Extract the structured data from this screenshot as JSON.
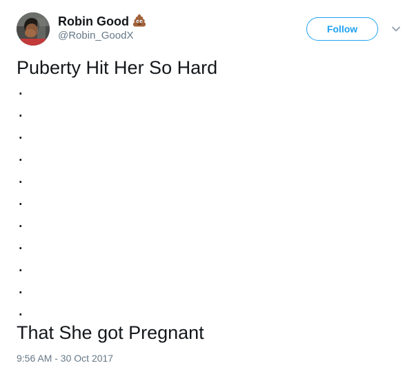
{
  "author": {
    "display_name": "Robin Good",
    "name_emoji": "pile-of-poo-emoji",
    "handle": "@Robin_GoodX"
  },
  "actions": {
    "follow_label": "Follow",
    "caret_icon": "chevron-down-icon"
  },
  "tweet": {
    "line_1": "Puberty Hit Her So Hard",
    "dots": [
      ".",
      ".",
      ".",
      ".",
      ".",
      ".",
      ".",
      ".",
      ".",
      ".",
      "."
    ],
    "line_2": "That She got Pregnant",
    "timestamp": "9:56 AM - 30 Oct 2017"
  },
  "colors": {
    "accent": "#1da1f2",
    "text": "#14171a",
    "muted": "#657786"
  }
}
